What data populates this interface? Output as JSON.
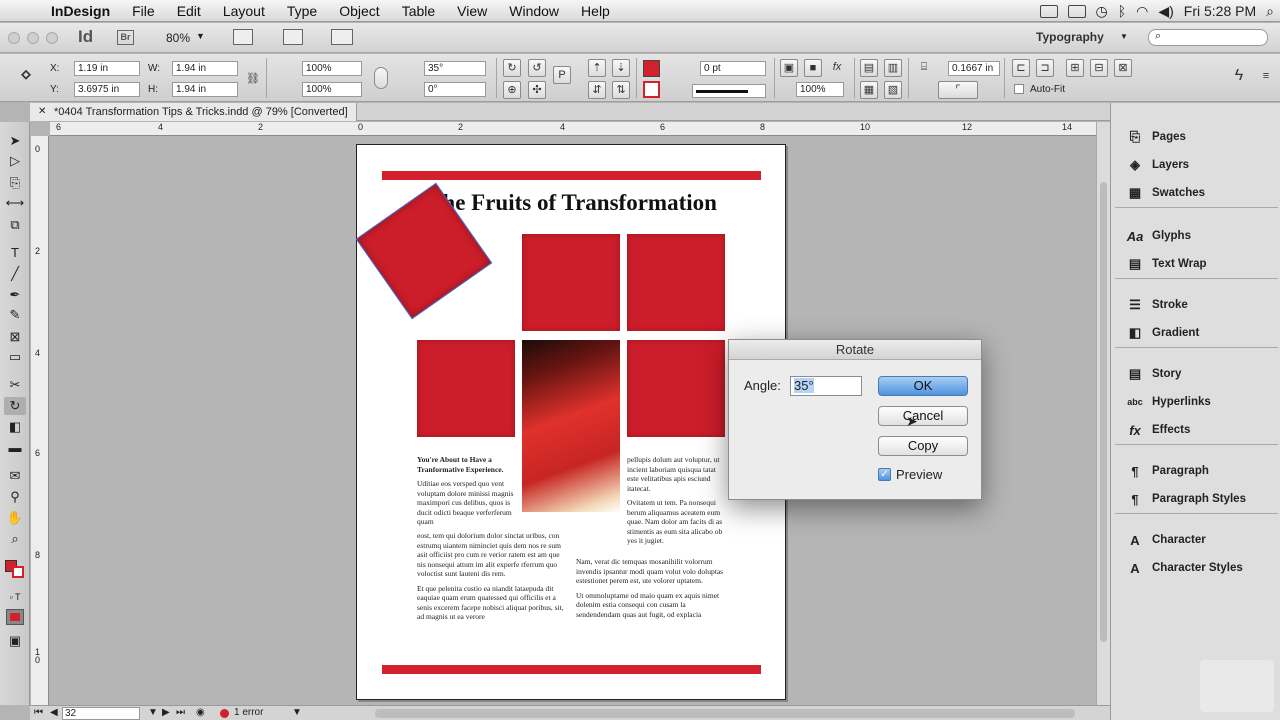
{
  "menubar": {
    "app_name": "InDesign",
    "items": [
      "File",
      "Edit",
      "Layout",
      "Type",
      "Object",
      "Table",
      "View",
      "Window",
      "Help"
    ],
    "clock": "Fri 5:28 PM"
  },
  "appbar": {
    "app_logo": "Id",
    "bridge": "Br",
    "zoom": "80%",
    "workspace": "Typography"
  },
  "control_panel": {
    "x_label": "X:",
    "x_value": "1.19 in",
    "y_label": "Y:",
    "y_value": "3.6975 in",
    "w_label": "W:",
    "w_value": "1.94 in",
    "h_label": "H:",
    "h_value": "1.94 in",
    "scale_x": "100%",
    "scale_y": "100%",
    "rotation": "35°",
    "shear": "0°",
    "stroke_weight": "0 pt",
    "opacity": "100%",
    "offset_value": "0.1667 in",
    "autofit_label": "Auto-Fit"
  },
  "document_tab": {
    "title": "*0404 Transformation Tips & Tricks.indd @ 79% [Converted]"
  },
  "rulers": {
    "h_ticks": [
      "6",
      "4",
      "2",
      "0",
      "2",
      "4",
      "6",
      "8",
      "10",
      "12",
      "14"
    ],
    "v_ticks": [
      "0",
      "2",
      "4",
      "6",
      "8",
      "1 0"
    ]
  },
  "page": {
    "title": "The Fruits of Transformation",
    "col1_heading": "You're About to Have a Tranformative Experience.",
    "col1_p1": "Uditiae eos versped quo vent voluptam dolore minissi magnis maximpori cus delibus, quos is ducit odicti beaque verferferum quam",
    "col1_p2": "eost, tem qui dolorium dolor sinctat uribus, con estrumq uiantem niminciet quis dem nos re sum asit officiist pro cum re verior ratem est am que nis nonsequi attum im alit experfe rferrum quo voloctist sunt lauteni dis rem.",
    "col1_p3": "Et que pelenita custio ea niandit lataepuda dit eaquiae quam erum quatessed qui officilis et a senis excerem facepe nobisci aliquat poribus, sit, ad magnis ut ea verore",
    "col2_p1": "pellupis dolum aut voluptur, ut incient laboriam quisqua tatat este velitatibus apis esciund itatecat.",
    "col2_p2": "Ovitatem ut tem. Pa nonsequi berum aliquamus aceatem eum quae. Nam dolor am facits di as stimentis as eum sita alicabo ob yes it jugiet.",
    "col2_p3": "Nam, verat dic temquas mosanihilit volorrum invendis ipsantur modi quam volut volo doluptas estestionet perem est, ute volorer uptatem.",
    "col2_p4": "Ut ommoluptame od maio quam ex aquis nimet dolenim estia consequi con cusam la sendendendam quas aut fugit, od explacia"
  },
  "dialog": {
    "title": "Rotate",
    "angle_label": "Angle:",
    "angle_value": "35°",
    "ok": "OK",
    "cancel": "Cancel",
    "copy": "Copy",
    "preview": "Preview",
    "preview_checked": true
  },
  "panels": [
    {
      "label": "Pages",
      "icon": "pages-icon"
    },
    {
      "label": "Layers",
      "icon": "layers-icon"
    },
    {
      "label": "Swatches",
      "icon": "swatches-icon"
    },
    {
      "label": "Glyphs",
      "icon": "glyphs-icon"
    },
    {
      "label": "Text Wrap",
      "icon": "text-wrap-icon"
    },
    {
      "label": "Stroke",
      "icon": "stroke-icon"
    },
    {
      "label": "Gradient",
      "icon": "gradient-icon"
    },
    {
      "label": "Story",
      "icon": "story-icon"
    },
    {
      "label": "Hyperlinks",
      "icon": "hyperlinks-icon"
    },
    {
      "label": "Effects",
      "icon": "effects-icon"
    },
    {
      "label": "Paragraph",
      "icon": "paragraph-icon"
    },
    {
      "label": "Paragraph Styles",
      "icon": "paragraph-styles-icon"
    },
    {
      "label": "Character",
      "icon": "character-icon"
    },
    {
      "label": "Character Styles",
      "icon": "character-styles-icon"
    }
  ],
  "statusbar": {
    "page_number": "32",
    "errors": "1 error"
  },
  "colors": {
    "brand_red": "#d3202d",
    "fill_red": "#cc1d2a",
    "ok_blue": "#4f93e0"
  }
}
